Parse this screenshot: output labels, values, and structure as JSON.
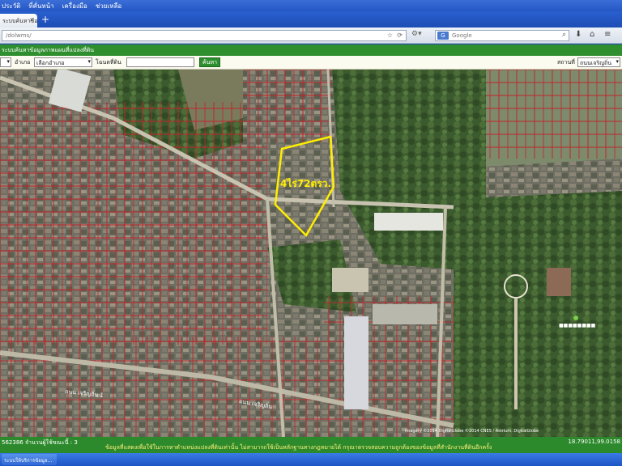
{
  "menubar": {
    "items": [
      "ประวัติ",
      "ที่คั่นหน้า",
      "เครื่องมือ",
      "ช่วยเหลือ"
    ]
  },
  "tab": {
    "title": "ระบบค้นหาข้อมูลแปลงที่ดิน",
    "close": "×",
    "new_tab": "+"
  },
  "navbar": {
    "url": "/dolwms/",
    "search_engine": "G",
    "search_placeholder": "Google"
  },
  "title_bar": {
    "text": "ระบบค้นหาข้อมูลภาพแผนที่แปลงที่ดิน"
  },
  "toolbar": {
    "province_arrow": "▾",
    "amphoe_label": "อำเภอ",
    "amphoe_value": "เลือกอำเภอ",
    "parcel_label": "โฉนดที่ดิน",
    "search_button": "ค้นหา",
    "location_label": "สถานที่",
    "location_value": "ถนนเจริญถิ่น"
  },
  "map": {
    "parcel_label": "4ไร่72ตรว.",
    "parcel_color": "#ffee00",
    "boundary_color": "#c0262b",
    "road_labels": [
      "ถนน เจริญถิ่น 1",
      "ถนน เจริญถิ่น"
    ],
    "attribution": "Imagery ©2014 DigitalGlobe ©2014 CNES / Astrium, DigitalGlobe"
  },
  "status": {
    "left": "562386 จำนวนผู้ใช้ขณะนี้ : 3",
    "notice": "ข้อมูลที่แสดงเพื่อใช้ในการหาตำแหน่งแปลงที่ดินเท่านั้น ไม่สามารถใช้เป็นหลักฐานทางกฎหมายได้ กรุณาตรวจสอบความถูกต้องของข้อมูลที่สำนักงานที่ดินอีกครั้ง",
    "coordinates": "18.79011,99.0158"
  },
  "taskbar": {
    "item": "ระบบให้บริการข้อมูล..."
  }
}
